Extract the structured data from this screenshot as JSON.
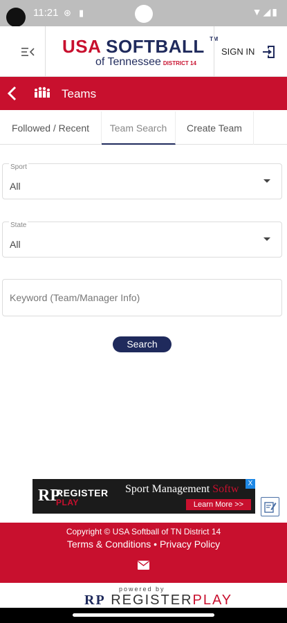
{
  "status_bar": {
    "time": "11:21"
  },
  "header": {
    "logo": {
      "usa": "USA",
      "softball": "SOFTBALL",
      "tm": "TM",
      "sub": "of Tennessee",
      "district": "DISTRICT 14"
    },
    "signin_label": "SIGN IN"
  },
  "title_bar": {
    "title": "Teams"
  },
  "tabs": [
    {
      "label": "Followed / Recent",
      "active": false
    },
    {
      "label": "Team Search",
      "active": true
    },
    {
      "label": "Create Team",
      "active": false
    }
  ],
  "form": {
    "sport": {
      "label": "Sport",
      "value": "All"
    },
    "state": {
      "label": "State",
      "value": "All"
    },
    "keyword": {
      "placeholder": "Keyword (Team/Manager Info)",
      "value": ""
    },
    "search_label": "Search"
  },
  "ad": {
    "logo_mark": "RP",
    "logo_top": "REGISTER",
    "logo_bottom": "PLAY",
    "headline": "Sport Management",
    "headline_faded": "Softw",
    "cta": "Learn More >>",
    "close": "X"
  },
  "footer": {
    "copyright": "Copyright © USA Softball of TN District 14",
    "terms": "Terms & Conditions",
    "separator": "•",
    "privacy": "Privacy Policy"
  },
  "powered": {
    "by": "powered by",
    "mark": "RP",
    "register": "REGISTER",
    "play": "PLAY"
  },
  "colors": {
    "brand_red": "#c8102e",
    "brand_navy": "#1f2a5c"
  },
  "icons": [
    "menu-icon",
    "signin-icon",
    "back-chevron-icon",
    "teams-icon",
    "caret-down-icon",
    "edit-icon",
    "mail-icon"
  ]
}
